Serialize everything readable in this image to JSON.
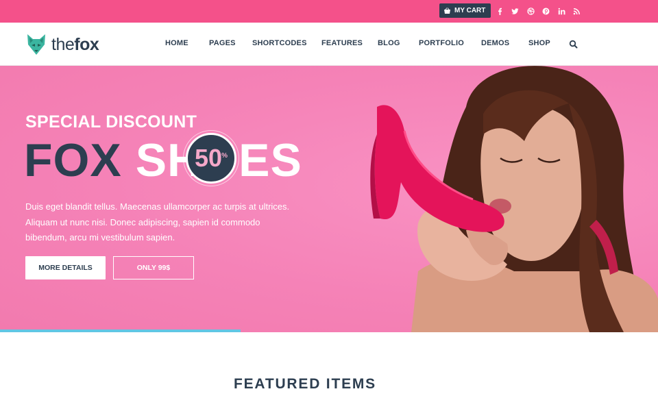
{
  "topbar": {
    "cart_label": "MY CART",
    "socials": [
      {
        "name": "facebook-icon",
        "glyph": "f"
      },
      {
        "name": "twitter-icon",
        "glyph": "t"
      },
      {
        "name": "dribbble-icon",
        "glyph": "d"
      },
      {
        "name": "pinterest-icon",
        "glyph": "p"
      },
      {
        "name": "linkedin-icon",
        "glyph": "in"
      },
      {
        "name": "rss-icon",
        "glyph": "rss"
      }
    ]
  },
  "header": {
    "logo_prefix": "the",
    "logo_bold": "fox",
    "nav": [
      "HOME",
      "PAGES",
      "SHORTCODES",
      "FEATURES",
      "BLOG",
      "PORTFOLIO",
      "DEMOS",
      "SHOP"
    ]
  },
  "hero": {
    "subtitle": "SPECIAL DISCOUNT",
    "title_dark": "FOX",
    "title_light_a": "SH",
    "title_light_b": "ES",
    "badge_number": "50",
    "badge_symbol": "%",
    "text": "Duis eget blandit tellus. Maecenas ullamcorper ac turpis at ultrices. Aliquam ut nunc nisi. Donec adipiscing, sapien id commodo bibendum, arcu mi vestibulum sapien.",
    "button_more": "MORE DETAILS",
    "button_price": "ONLY 99$",
    "slide_progress": 0.366
  },
  "featured": {
    "title": "FEATURED ITEMS"
  },
  "colors": {
    "topbar": "#f4518a",
    "hero_bg": "#f781b7",
    "navy": "#2d3e50",
    "progress": "#61c6e4",
    "logo_teal": "#3bb5a0"
  }
}
